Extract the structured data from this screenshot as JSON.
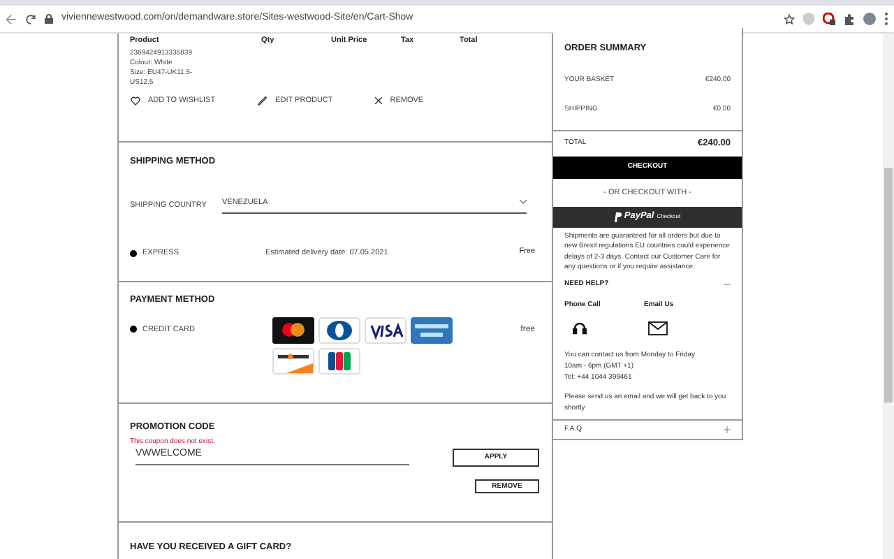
{
  "browser": {
    "url": "viviennewestwood.com/on/demandware.store/Sites-westwood-Site/en/Cart-Show"
  },
  "cart": {
    "columns": [
      "Product",
      "Qty",
      "Unit Price",
      "Tax",
      "Total"
    ],
    "product_lines": [
      "2369424913335839",
      "Colour: White",
      "Size: EU47-UK11.5-US12.5"
    ],
    "actions": [
      {
        "kind": "heart",
        "label": "ADD TO WISHLIST"
      },
      {
        "kind": "pencil",
        "label": "EDIT PRODUCT"
      },
      {
        "kind": "cross",
        "label": "REMOVE"
      }
    ]
  },
  "shipping": {
    "title": "SHIPPING METHOD",
    "country_label": "SHIPPING COUNTRY",
    "country": "VENEZUELA",
    "options": [
      {
        "name": "EXPRESS",
        "selected": true,
        "delivery": "Estimated delivery date: 07.05.2021",
        "price": "Free"
      }
    ]
  },
  "payment": {
    "title": "PAYMENT METHOD",
    "options": [
      {
        "name": "CREDIT CARD",
        "selected": true,
        "price": "free"
      }
    ],
    "cards": [
      {
        "kind": "mastercard"
      },
      {
        "kind": "diners"
      },
      {
        "kind": "visa"
      },
      {
        "kind": "amex"
      },
      {
        "kind": "discover"
      },
      {
        "kind": "jcb"
      }
    ]
  },
  "promotion": {
    "title": "PROMOTION CODE",
    "error": "This coupon does not exist.",
    "value": "VWWELCOME",
    "apply": "APPLY",
    "remove": "REMOVE"
  },
  "gift_card": {
    "title": "HAVE YOU RECEIVED A GIFT CARD?"
  },
  "summary": {
    "title": "ORDER SUMMARY",
    "rows": [
      {
        "label": "YOUR BASKET",
        "value": "€240.00"
      },
      {
        "label": "SHIPPING",
        "value": "€0.00"
      }
    ],
    "total_label": "TOTAL",
    "total": "€240.00",
    "checkout": "CHECKOUT",
    "alt_checkout": "- OR CHECKOUT WITH -",
    "paypal_word": "PayPal",
    "paypal_suffix": "Checkout",
    "notice": "Shipments are guaranteed for all orders but due to new Brexit regulations EU countries could experience delays of 2-3 days. Contact our Customer Care for any questions or if you require assistance.",
    "help": {
      "title": "NEED HELP?",
      "expanded": true,
      "phone": "Phone Call",
      "email": "Email Us",
      "hours": [
        "You can contact us from Monday to Friday",
        "10am - 6pm (GMT +1)",
        "Tel: +44 1044 399461"
      ],
      "email_note": "Please send us an email and we will get back to you shortly"
    },
    "faq": {
      "title": "F.A.Q",
      "expanded": false
    }
  }
}
